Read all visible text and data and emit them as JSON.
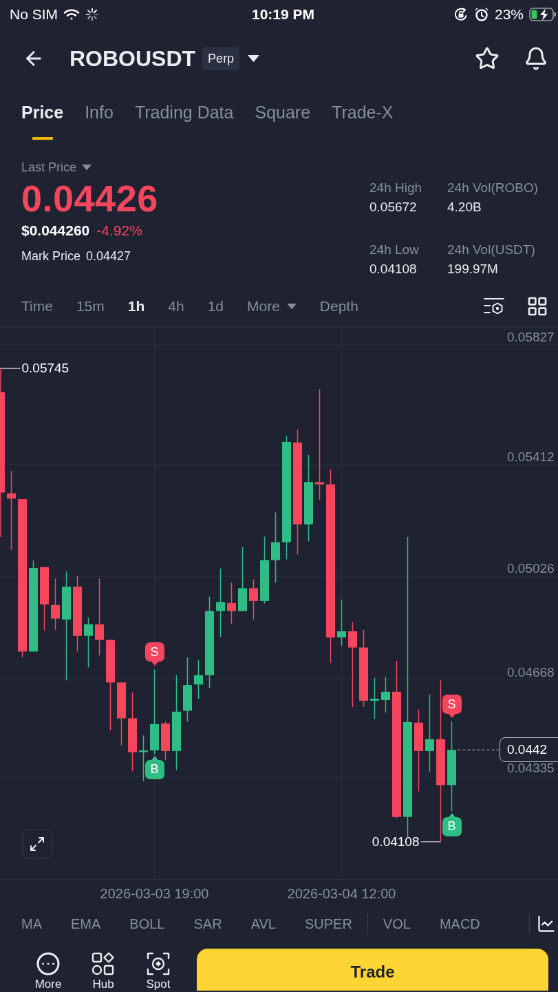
{
  "status_bar": {
    "carrier": "No SIM",
    "time": "10:19 PM",
    "battery": "23%"
  },
  "header": {
    "symbol": "ROBOUSDT",
    "badge": "Perp"
  },
  "tabs": [
    {
      "label": "Price",
      "selected": true
    },
    {
      "label": "Info",
      "selected": false
    },
    {
      "label": "Trading Data",
      "selected": false
    },
    {
      "label": "Square",
      "selected": false
    },
    {
      "label": "Trade-X",
      "selected": false
    }
  ],
  "price": {
    "label": "Last Price",
    "last": "0.04426",
    "usd": "$0.044260",
    "change": "-4.92%",
    "mark_label": "Mark Price",
    "mark": "0.04427"
  },
  "stats": [
    {
      "label": "24h High",
      "value": "0.05672"
    },
    {
      "label": "24h Vol(ROBO)",
      "value": "4.20B"
    },
    {
      "label": "24h Low",
      "value": "0.04108"
    },
    {
      "label": "24h Vol(USDT)",
      "value": "199.97M"
    }
  ],
  "intervals": [
    {
      "label": "Time",
      "kind": "plain",
      "selected": false
    },
    {
      "label": "15m",
      "kind": "plain",
      "selected": false
    },
    {
      "label": "1h",
      "kind": "plain",
      "selected": true
    },
    {
      "label": "4h",
      "kind": "plain",
      "selected": false
    },
    {
      "label": "1d",
      "kind": "plain",
      "selected": false
    },
    {
      "label": "More",
      "kind": "dropdown",
      "selected": false
    },
    {
      "label": "Depth",
      "kind": "plain",
      "selected": false
    }
  ],
  "chart": {
    "current_price": "0.0442",
    "trade_markers": [
      {
        "label": "S",
        "kind": "sell"
      },
      {
        "label": "B",
        "kind": "buy"
      },
      {
        "label": "S",
        "kind": "sell"
      },
      {
        "label": "B",
        "kind": "buy"
      }
    ],
    "chart_data": {
      "type": "candlestick",
      "grid": true,
      "categories": [
        null,
        null,
        null,
        null,
        null,
        null,
        null,
        null,
        null,
        null,
        null,
        null,
        null,
        null,
        "2026-03-03 19:00",
        null,
        null,
        null,
        null,
        null,
        null,
        null,
        null,
        null,
        null,
        null,
        null,
        null,
        null,
        null,
        null,
        "2026-03-04 12:00",
        null,
        null,
        null,
        null,
        null,
        null,
        null,
        null,
        null,
        null
      ],
      "ohlc": [
        [
          0.05663,
          0.05745,
          0.05162,
          0.05316
        ],
        [
          0.05313,
          0.05391,
          0.05117,
          0.05295
        ],
        [
          0.05293,
          0.05293,
          0.04746,
          0.04766
        ],
        [
          0.04766,
          0.0508,
          0.04766,
          0.05055
        ],
        [
          0.05058,
          0.05058,
          0.04839,
          0.04929
        ],
        [
          0.04927,
          0.05019,
          0.04841,
          0.0488
        ],
        [
          0.04877,
          0.05043,
          0.04666,
          0.0499
        ],
        [
          0.0499,
          0.05028,
          0.04766,
          0.0482
        ],
        [
          0.0482,
          0.04884,
          0.04711,
          0.0486
        ],
        [
          0.0486,
          0.05019,
          0.04753,
          0.04806
        ],
        [
          0.04806,
          0.04806,
          0.04493,
          0.04659
        ],
        [
          0.04659,
          0.04659,
          0.04441,
          0.04535
        ],
        [
          0.04535,
          0.04625,
          0.04352,
          0.04418
        ],
        [
          0.04418,
          0.04476,
          0.04318,
          0.04424
        ],
        [
          0.04424,
          0.04704,
          0.04411,
          0.04515
        ],
        [
          0.04517,
          0.04524,
          0.0439,
          0.04422
        ],
        [
          0.04422,
          0.04684,
          0.04356,
          0.04558
        ],
        [
          0.04561,
          0.04746,
          0.04524,
          0.0465
        ],
        [
          0.04652,
          0.04736,
          0.04603,
          0.04684
        ],
        [
          0.04684,
          0.04956,
          0.04641,
          0.04906
        ],
        [
          0.04906,
          0.05053,
          0.04817,
          0.04937
        ],
        [
          0.04934,
          0.05004,
          0.04862,
          0.04906
        ],
        [
          0.04906,
          0.05127,
          0.04906,
          0.04985
        ],
        [
          0.04985,
          0.05016,
          0.04877,
          0.04941
        ],
        [
          0.04941,
          0.05164,
          0.04932,
          0.05082
        ],
        [
          0.05082,
          0.05247,
          0.05004,
          0.05144
        ],
        [
          0.05144,
          0.05513,
          0.05085,
          0.05491
        ],
        [
          0.05489,
          0.05534,
          0.05102,
          0.05206
        ],
        [
          0.05206,
          0.05446,
          0.05147,
          0.05352
        ],
        [
          0.05352,
          0.05674,
          0.0529,
          0.05344
        ],
        [
          0.05344,
          0.05396,
          0.04727,
          0.04815
        ],
        [
          0.04815,
          0.04946,
          0.04785,
          0.04836
        ],
        [
          0.04836,
          0.04867,
          0.04574,
          0.0478
        ],
        [
          0.0478,
          0.04841,
          0.04574,
          0.04596
        ],
        [
          0.04596,
          0.04675,
          0.04533,
          0.04603
        ],
        [
          0.04598,
          0.04679,
          0.04554,
          0.04627
        ],
        [
          0.04627,
          0.04734,
          0.0419,
          0.04194
        ],
        [
          0.04194,
          0.05162,
          0.04124,
          0.04522
        ],
        [
          0.0452,
          0.04565,
          0.04283,
          0.04422
        ],
        [
          0.04422,
          0.04618,
          0.0435,
          0.04463
        ],
        [
          0.04463,
          0.04668,
          0.04108,
          0.04304
        ],
        [
          0.04304,
          0.04524,
          0.04213,
          0.04426
        ]
      ],
      "ylim": [
        0.03979,
        0.05886
      ],
      "yticks": [
        0.05827,
        0.05412,
        0.05026,
        0.04668,
        0.04335
      ],
      "annotations": [
        "0.05745",
        "0.04108"
      ]
    }
  },
  "indicators": [
    {
      "label": "MA",
      "kind": "main"
    },
    {
      "label": "EMA",
      "kind": "main"
    },
    {
      "label": "BOLL",
      "kind": "main"
    },
    {
      "label": "SAR",
      "kind": "main"
    },
    {
      "label": "AVL",
      "kind": "main"
    },
    {
      "label": "SUPER",
      "kind": "main"
    },
    {
      "label": "VOL",
      "kind": "sub"
    },
    {
      "label": "MACD",
      "kind": "sub"
    }
  ],
  "bottom_nav": [
    {
      "label": "More",
      "kind": "more"
    },
    {
      "label": "Hub",
      "kind": "hub"
    },
    {
      "label": "Spot",
      "kind": "spot"
    }
  ],
  "trade_button": {
    "label": "Trade"
  }
}
